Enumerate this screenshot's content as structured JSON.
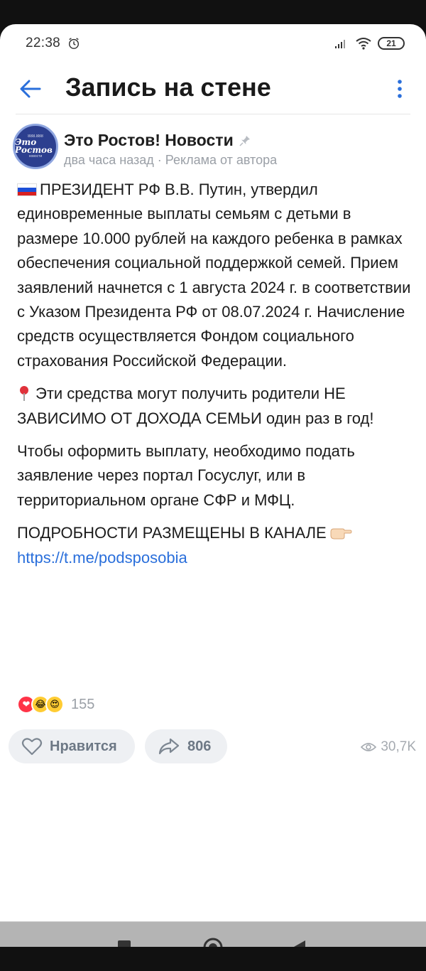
{
  "status_bar": {
    "time": "22:38",
    "battery": "21",
    "icons": [
      "alarm-icon",
      "signal-icon",
      "wifi-icon",
      "battery-icon"
    ]
  },
  "header": {
    "title": "Запись на стене",
    "back_icon": "arrow-left-icon",
    "menu_icon": "more-vertical-icon"
  },
  "post": {
    "author": "Это Ростов! Новости",
    "avatar_text": {
      "top": "888.888",
      "main": "Это Ростов",
      "bottom": "новости"
    },
    "meta": "два часа назад · Реклама от автора",
    "paragraph1": "ПРЕЗИДЕНТ РФ В.В. Путин, утвердил единовременные выплаты семьям с детьми в размере 10.000 рублей на каждого ребенка в рамках обеспечения социальной поддержкой семей. Прием заявлений начнется с 1 августа 2024 г. в соответствии с Указом Президента РФ от 08.07.2024 г. Начисление средств осуществляется Фондом социального страхования Российской Федерации.",
    "paragraph2": "Эти средства могут получить родители НЕ ЗАВИСИМО ОТ ДОХОДА СЕМЬИ один раз в год!",
    "paragraph3": "Чтобы оформить выплату, необходимо подать заявление через портал Госуслуг, или в территориальном органе СФР и МФЦ.",
    "paragraph4": "ПОДРОБНОСТИ РАЗМЕЩЕНЫ В КАНАЛЕ",
    "link": "https://t.me/podsposobia",
    "reactions_count": "155",
    "like_label": "Нравится",
    "share_count": "806",
    "views": "30,7K"
  },
  "colors": {
    "accent": "#2a6fdb",
    "muted": "#9a9fa6",
    "button_bg": "#eef0f3"
  }
}
